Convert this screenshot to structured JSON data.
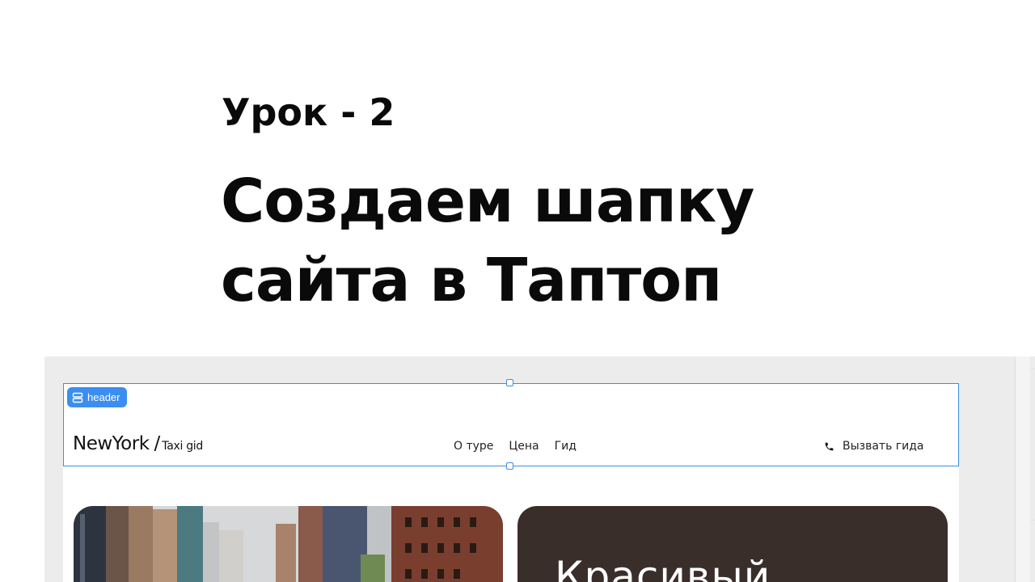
{
  "lesson": {
    "label": "Урок - 2",
    "title_line1": "Создаем шапку",
    "title_line2": "сайта в Таптоп"
  },
  "editor": {
    "block_badge": "header",
    "block_badge_icon": "layout-rows-icon",
    "selection_color": "#3d8fe0"
  },
  "site_header": {
    "logo_main": "NewYork",
    "logo_slash": "/",
    "logo_sub": "Taxi gid",
    "nav": [
      "О туре",
      "Цена",
      "Гид"
    ],
    "call_icon": "phone-icon",
    "call_label": "Вызвать гида"
  },
  "hero": {
    "heading": "Красивый",
    "dark_panel_color": "#3a2e2b"
  }
}
